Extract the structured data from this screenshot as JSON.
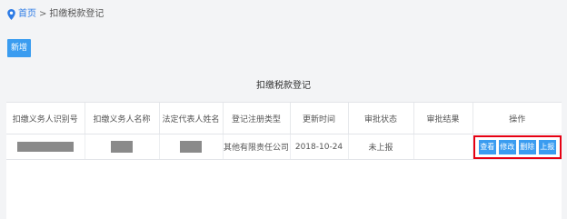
{
  "breadcrumb": {
    "icon": "location-pin-icon",
    "home": "首页",
    "separator": ">",
    "current": "扣缴税款登记"
  },
  "toolbar": {
    "new_label": "新增"
  },
  "page_title": "扣缴税款登记",
  "table": {
    "headers": [
      "扣缴义务人识别号",
      "扣缴义务人名称",
      "法定代表人姓名",
      "登记注册类型",
      "更新时间",
      "审批状态",
      "审批结果",
      "操作"
    ],
    "rows": [
      {
        "registration_type": "其他有限责任公司",
        "update_time": "2018-10-24",
        "approval_status": "未上报",
        "approval_result": "",
        "actions": [
          "查看",
          "修改",
          "删除",
          "上报"
        ]
      }
    ]
  },
  "colors": {
    "accent": "#3a9cf0",
    "link": "#2d7be5",
    "highlight": "#e60012",
    "background": "#f3f4f6"
  }
}
